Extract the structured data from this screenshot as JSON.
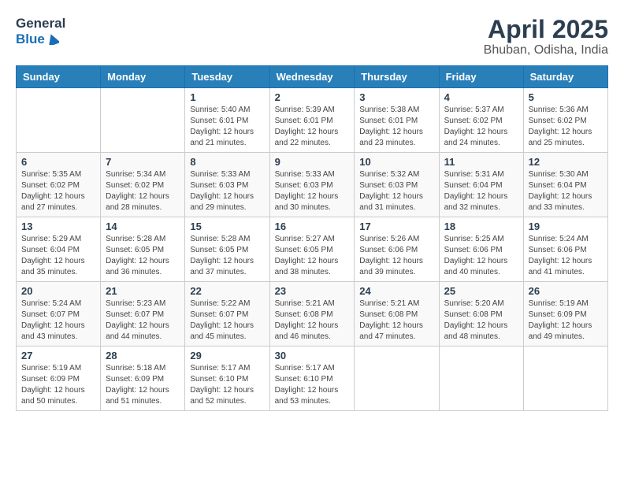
{
  "header": {
    "logo_general": "General",
    "logo_blue": "Blue",
    "month": "April 2025",
    "location": "Bhuban, Odisha, India"
  },
  "weekdays": [
    "Sunday",
    "Monday",
    "Tuesday",
    "Wednesday",
    "Thursday",
    "Friday",
    "Saturday"
  ],
  "weeks": [
    [
      {
        "day": "",
        "info": ""
      },
      {
        "day": "",
        "info": ""
      },
      {
        "day": "1",
        "info": "Sunrise: 5:40 AM\nSunset: 6:01 PM\nDaylight: 12 hours\nand 21 minutes."
      },
      {
        "day": "2",
        "info": "Sunrise: 5:39 AM\nSunset: 6:01 PM\nDaylight: 12 hours\nand 22 minutes."
      },
      {
        "day": "3",
        "info": "Sunrise: 5:38 AM\nSunset: 6:01 PM\nDaylight: 12 hours\nand 23 minutes."
      },
      {
        "day": "4",
        "info": "Sunrise: 5:37 AM\nSunset: 6:02 PM\nDaylight: 12 hours\nand 24 minutes."
      },
      {
        "day": "5",
        "info": "Sunrise: 5:36 AM\nSunset: 6:02 PM\nDaylight: 12 hours\nand 25 minutes."
      }
    ],
    [
      {
        "day": "6",
        "info": "Sunrise: 5:35 AM\nSunset: 6:02 PM\nDaylight: 12 hours\nand 27 minutes."
      },
      {
        "day": "7",
        "info": "Sunrise: 5:34 AM\nSunset: 6:02 PM\nDaylight: 12 hours\nand 28 minutes."
      },
      {
        "day": "8",
        "info": "Sunrise: 5:33 AM\nSunset: 6:03 PM\nDaylight: 12 hours\nand 29 minutes."
      },
      {
        "day": "9",
        "info": "Sunrise: 5:33 AM\nSunset: 6:03 PM\nDaylight: 12 hours\nand 30 minutes."
      },
      {
        "day": "10",
        "info": "Sunrise: 5:32 AM\nSunset: 6:03 PM\nDaylight: 12 hours\nand 31 minutes."
      },
      {
        "day": "11",
        "info": "Sunrise: 5:31 AM\nSunset: 6:04 PM\nDaylight: 12 hours\nand 32 minutes."
      },
      {
        "day": "12",
        "info": "Sunrise: 5:30 AM\nSunset: 6:04 PM\nDaylight: 12 hours\nand 33 minutes."
      }
    ],
    [
      {
        "day": "13",
        "info": "Sunrise: 5:29 AM\nSunset: 6:04 PM\nDaylight: 12 hours\nand 35 minutes."
      },
      {
        "day": "14",
        "info": "Sunrise: 5:28 AM\nSunset: 6:05 PM\nDaylight: 12 hours\nand 36 minutes."
      },
      {
        "day": "15",
        "info": "Sunrise: 5:28 AM\nSunset: 6:05 PM\nDaylight: 12 hours\nand 37 minutes."
      },
      {
        "day": "16",
        "info": "Sunrise: 5:27 AM\nSunset: 6:05 PM\nDaylight: 12 hours\nand 38 minutes."
      },
      {
        "day": "17",
        "info": "Sunrise: 5:26 AM\nSunset: 6:06 PM\nDaylight: 12 hours\nand 39 minutes."
      },
      {
        "day": "18",
        "info": "Sunrise: 5:25 AM\nSunset: 6:06 PM\nDaylight: 12 hours\nand 40 minutes."
      },
      {
        "day": "19",
        "info": "Sunrise: 5:24 AM\nSunset: 6:06 PM\nDaylight: 12 hours\nand 41 minutes."
      }
    ],
    [
      {
        "day": "20",
        "info": "Sunrise: 5:24 AM\nSunset: 6:07 PM\nDaylight: 12 hours\nand 43 minutes."
      },
      {
        "day": "21",
        "info": "Sunrise: 5:23 AM\nSunset: 6:07 PM\nDaylight: 12 hours\nand 44 minutes."
      },
      {
        "day": "22",
        "info": "Sunrise: 5:22 AM\nSunset: 6:07 PM\nDaylight: 12 hours\nand 45 minutes."
      },
      {
        "day": "23",
        "info": "Sunrise: 5:21 AM\nSunset: 6:08 PM\nDaylight: 12 hours\nand 46 minutes."
      },
      {
        "day": "24",
        "info": "Sunrise: 5:21 AM\nSunset: 6:08 PM\nDaylight: 12 hours\nand 47 minutes."
      },
      {
        "day": "25",
        "info": "Sunrise: 5:20 AM\nSunset: 6:08 PM\nDaylight: 12 hours\nand 48 minutes."
      },
      {
        "day": "26",
        "info": "Sunrise: 5:19 AM\nSunset: 6:09 PM\nDaylight: 12 hours\nand 49 minutes."
      }
    ],
    [
      {
        "day": "27",
        "info": "Sunrise: 5:19 AM\nSunset: 6:09 PM\nDaylight: 12 hours\nand 50 minutes."
      },
      {
        "day": "28",
        "info": "Sunrise: 5:18 AM\nSunset: 6:09 PM\nDaylight: 12 hours\nand 51 minutes."
      },
      {
        "day": "29",
        "info": "Sunrise: 5:17 AM\nSunset: 6:10 PM\nDaylight: 12 hours\nand 52 minutes."
      },
      {
        "day": "30",
        "info": "Sunrise: 5:17 AM\nSunset: 6:10 PM\nDaylight: 12 hours\nand 53 minutes."
      },
      {
        "day": "",
        "info": ""
      },
      {
        "day": "",
        "info": ""
      },
      {
        "day": "",
        "info": ""
      }
    ]
  ]
}
